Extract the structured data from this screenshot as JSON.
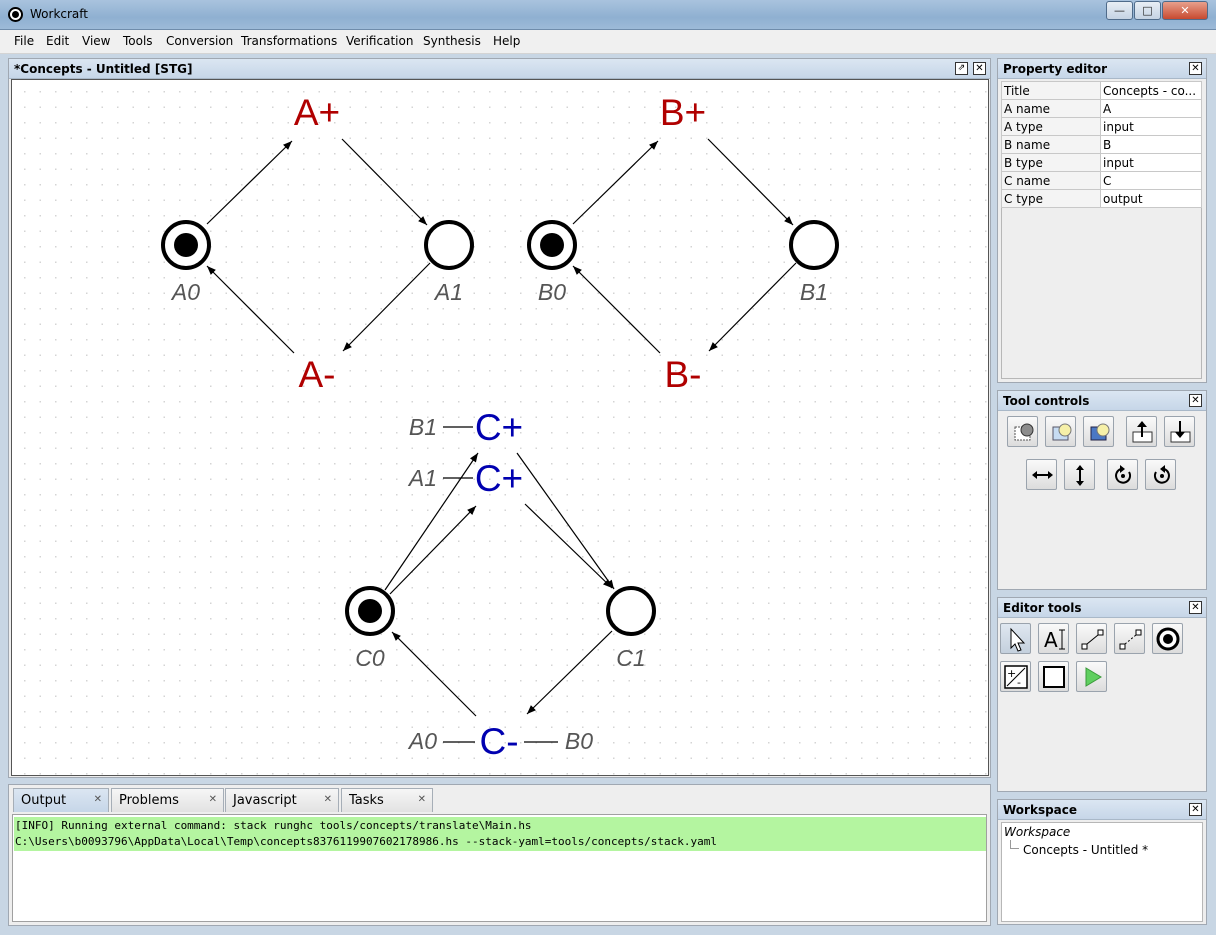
{
  "window": {
    "title": "Workcraft",
    "min": "—",
    "max": "□",
    "close": "✕"
  },
  "menu": [
    "File",
    "Edit",
    "View",
    "Tools",
    "Conversion",
    "Transformations",
    "Verification",
    "Synthesis",
    "Help"
  ],
  "editor": {
    "title": "*Concepts - Untitled [STG]",
    "float": "⇗",
    "close": "✕"
  },
  "stg": {
    "transitions": [
      {
        "id": "a-plus",
        "label": "A+",
        "kind": "input"
      },
      {
        "id": "a-minus",
        "label": "A-",
        "kind": "input"
      },
      {
        "id": "b-plus",
        "label": "B+",
        "kind": "input"
      },
      {
        "id": "b-minus",
        "label": "B-",
        "kind": "input"
      },
      {
        "id": "c-plus-1",
        "label": "C+",
        "kind": "output"
      },
      {
        "id": "c-plus-2",
        "label": "C+",
        "kind": "output"
      },
      {
        "id": "c-minus",
        "label": "C-",
        "kind": "output"
      }
    ],
    "places": [
      {
        "id": "A0",
        "label": "A0",
        "marked": true
      },
      {
        "id": "A1",
        "label": "A1",
        "marked": false
      },
      {
        "id": "B0",
        "label": "B0",
        "marked": true
      },
      {
        "id": "B1",
        "label": "B1",
        "marked": false
      },
      {
        "id": "C0",
        "label": "C0",
        "marked": true
      },
      {
        "id": "C1",
        "label": "C1",
        "marked": false
      }
    ],
    "read_arcs": [
      {
        "id": "read-b1",
        "label": "B1"
      },
      {
        "id": "read-a1",
        "label": "A1"
      },
      {
        "id": "read-a0",
        "label": "A0"
      },
      {
        "id": "read-b0",
        "label": "B0"
      }
    ],
    "colors": {
      "input": "#b00000",
      "output": "#0000b0",
      "place_label": "#555555"
    }
  },
  "property_editor": {
    "title": "Property editor",
    "rows": [
      {
        "key": "Title",
        "value": "Concepts - co..."
      },
      {
        "key": "A name",
        "value": "A"
      },
      {
        "key": "A type",
        "value": "input"
      },
      {
        "key": "B name",
        "value": "B"
      },
      {
        "key": "B type",
        "value": "input"
      },
      {
        "key": "C name",
        "value": "C"
      },
      {
        "key": "C type",
        "value": "output"
      }
    ]
  },
  "tool_controls": {
    "title": "Tool controls"
  },
  "editor_tools": {
    "title": "Editor tools",
    "text_tool": "A"
  },
  "workspace": {
    "title": "Workspace",
    "root": "Workspace",
    "item": "Concepts - Untitled *"
  },
  "output": {
    "tabs": [
      "Output",
      "Problems",
      "Javascript",
      "Tasks"
    ],
    "lines": [
      "[INFO] Running external command: stack runghc tools/concepts/translate\\Main.hs",
      "C:\\Users\\b0093796\\AppData\\Local\\Temp\\concepts8376119907602178986.hs --stack-yaml=tools/concepts/stack.yaml"
    ]
  }
}
